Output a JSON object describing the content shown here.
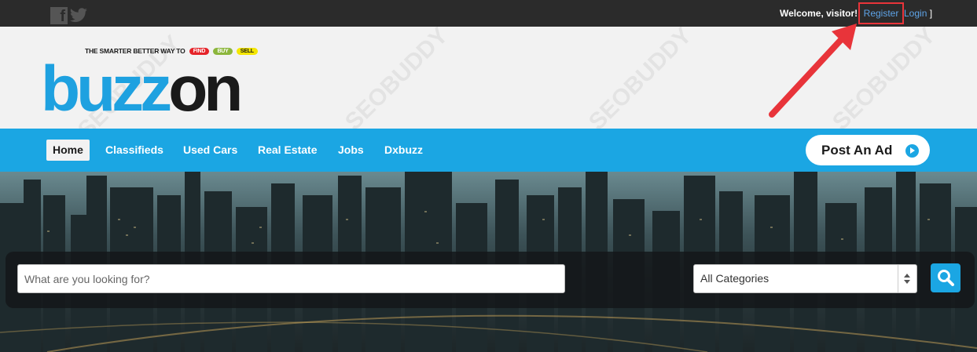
{
  "topbar": {
    "social_icons": [
      "facebook-icon",
      "twitter-icon"
    ],
    "welcome_text": "Welcome, visitor!",
    "register_label": "Register",
    "login_label": "Login",
    "bracket_open": "[",
    "bracket_close": "]"
  },
  "header": {
    "tagline": "THE SMARTER BETTER WAY TO",
    "tag_find": "FIND",
    "tag_buy": "BUY",
    "tag_sell": "SELL",
    "logo_part1": "buzz",
    "logo_part2": "on"
  },
  "nav": {
    "items": [
      {
        "label": "Home",
        "active": true
      },
      {
        "label": "Classifieds"
      },
      {
        "label": "Used Cars"
      },
      {
        "label": "Real Estate"
      },
      {
        "label": "Jobs"
      },
      {
        "label": "Dxbuzz"
      }
    ],
    "post_ad_label": "Post An Ad"
  },
  "search": {
    "placeholder": "What are you looking for?",
    "category_selected": "All Categories"
  },
  "watermark": "SEOBUDDY",
  "colors": {
    "brand_blue": "#1ba6e3",
    "highlight_red": "#e8343a",
    "link_blue": "#5ea4e8"
  }
}
